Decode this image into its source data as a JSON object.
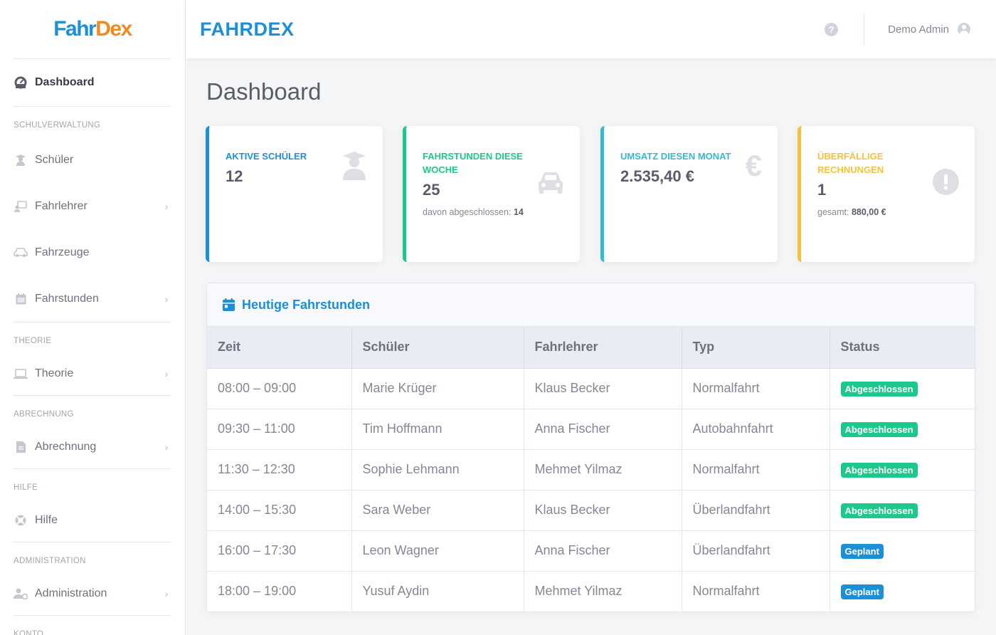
{
  "brand": {
    "part1": "Fahr",
    "part2": "Dex"
  },
  "app_title": "FAHRDEX",
  "topbar": {
    "user_name": "Demo Admin"
  },
  "page_title": "Dashboard",
  "sidebar": {
    "dashboard": "Dashboard",
    "headings": [
      "SCHULVERWALTUNG",
      "THEORIE",
      "ABRECHNUNG",
      "HILFE",
      "ADMINISTRATION",
      "KONTO"
    ],
    "items": {
      "schueler": "Schüler",
      "fahrlehrer": "Fahrlehrer",
      "fahrzeuge": "Fahrzeuge",
      "fahrstunden": "Fahrstunden",
      "theorie": "Theorie",
      "abrechnung": "Abrechnung",
      "hilfe": "Hilfe",
      "administration": "Administration"
    }
  },
  "cards": [
    {
      "label": "AKTIVE SCHÜLER",
      "value": "12"
    },
    {
      "label": "FAHRSTUNDEN DIESE WOCHE",
      "value": "25",
      "sub_prefix": "davon abgeschlossen:",
      "sub_value": "14"
    },
    {
      "label": "UMSATZ DIESEN MONAT",
      "value": "2.535,40 €"
    },
    {
      "label": "ÜBERFÄLLIGE RECHNUNGEN",
      "value": "1",
      "sub_prefix": "gesamt:",
      "sub_value": "880,00 €"
    }
  ],
  "table": {
    "title": "Heutige Fahrstunden",
    "headers": [
      "Zeit",
      "Schüler",
      "Fahrlehrer",
      "Typ",
      "Status"
    ],
    "rows": [
      [
        "08:00 – 09:00",
        "Marie Krüger",
        "Klaus Becker",
        "Normalfahrt",
        "Abgeschlossen"
      ],
      [
        "09:30 – 11:00",
        "Tim Hoffmann",
        "Anna Fischer",
        "Autobahnfahrt",
        "Abgeschlossen"
      ],
      [
        "11:30 – 12:30",
        "Sophie Lehmann",
        "Mehmet Yilmaz",
        "Normalfahrt",
        "Abgeschlossen"
      ],
      [
        "14:00 – 15:30",
        "Sara Weber",
        "Klaus Becker",
        "Überlandfahrt",
        "Abgeschlossen"
      ],
      [
        "16:00 – 17:30",
        "Leon Wagner",
        "Anna Fischer",
        "Überlandfahrt",
        "Geplant"
      ],
      [
        "18:00 – 19:00",
        "Yusuf Aydin",
        "Mehmet Yilmaz",
        "Normalfahrt",
        "Geplant"
      ]
    ]
  },
  "colors": {
    "primary": "#1b8fd8",
    "success": "#1cc88a",
    "info": "#36b9cc",
    "warning": "#f6c23e",
    "brand_orange": "#f08a24"
  }
}
